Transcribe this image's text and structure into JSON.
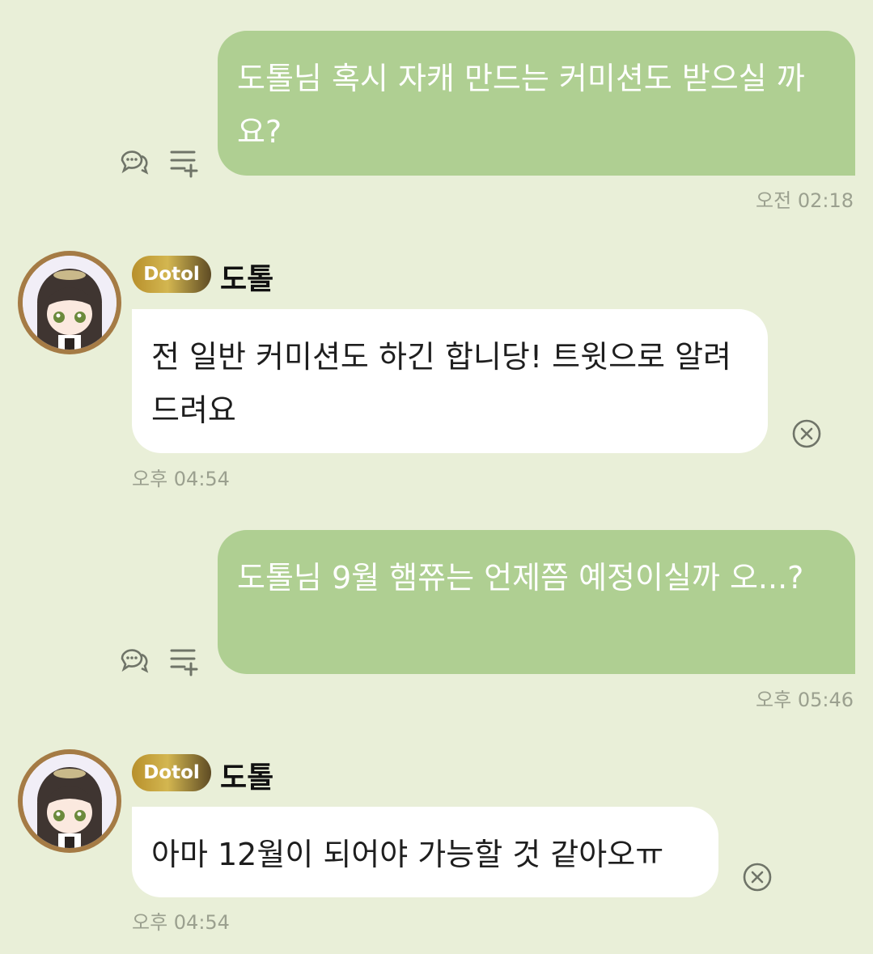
{
  "messages": {
    "m1": {
      "text": "도톨님 혹시 자캐 만드는 커미션도 받으실 까요?",
      "time": "오전 02:18"
    },
    "m2": {
      "sender": "도톨",
      "badge": "Dotol",
      "text": "전 일반 커미션도 하긴 합니당! 트윗으로 알려드려요",
      "time": "오후 04:54"
    },
    "m3": {
      "text": "도톨님 9월 햄쮸는 언제쯤 예정이실까 오...?",
      "time": "오후 05:46"
    },
    "m4": {
      "sender": "도톨",
      "badge": "Dotol",
      "text": "아마 12월이 되어야 가능할 것 같아오ㅠ",
      "time": "오후 04:54"
    }
  },
  "icons": [
    "reply-bubble-icon",
    "add-list-icon",
    "close-circle-icon",
    "avatar-image"
  ],
  "colors": {
    "background": "#e9efd8",
    "outgoing_bubble": "#afcf92",
    "incoming_bubble": "#ffffff",
    "badge_gold": "#c9a540"
  }
}
